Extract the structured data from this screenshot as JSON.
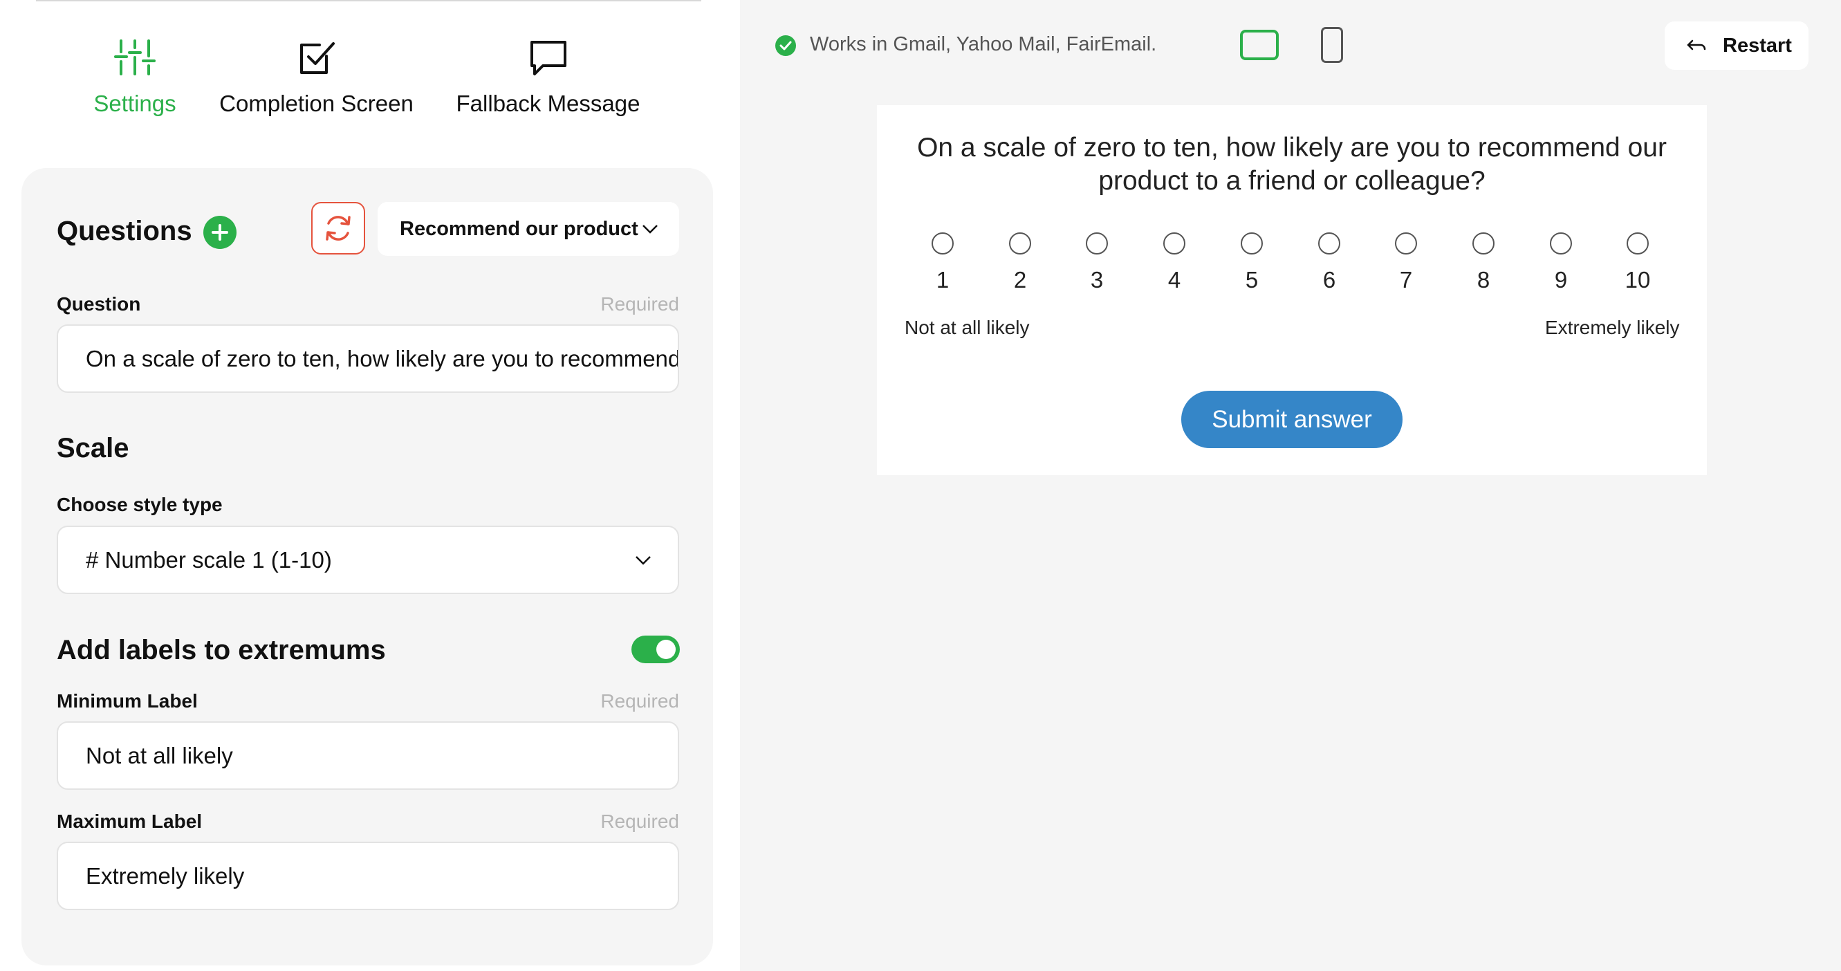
{
  "tabs": [
    {
      "label": "Settings",
      "icon": "sliders-icon",
      "active": true
    },
    {
      "label": "Completion Screen",
      "icon": "checkbox-icon",
      "active": false
    },
    {
      "label": "Fallback Message",
      "icon": "chat-bubble-icon",
      "active": false
    }
  ],
  "questions": {
    "title": "Questions",
    "selected_question": "Recommend our product",
    "question_label": "Question",
    "question_required": "Required",
    "question_value": "On a scale of zero to ten, how likely are you to recommend our product to a friend or colleague?"
  },
  "scale": {
    "title": "Scale",
    "style_label": "Choose style type",
    "style_value": "# Number scale 1 (1-10)"
  },
  "extremums": {
    "title": "Add labels to extremums",
    "enabled": true,
    "min_label": "Minimum Label",
    "min_required": "Required",
    "min_value": "Not at all likely",
    "max_label": "Maximum Label",
    "max_required": "Required",
    "max_value": "Extremely likely"
  },
  "preview": {
    "compatibility": "Works in Gmail, Yahoo Mail, FairEmail.",
    "restart_label": "Restart",
    "question": "On a scale of zero to ten, how likely are you to recommend our product to a friend or colleague?",
    "scale": [
      "1",
      "2",
      "3",
      "4",
      "5",
      "6",
      "7",
      "8",
      "9",
      "10"
    ],
    "min_label": "Not at all likely",
    "max_label": "Extremely likely",
    "submit_label": "Submit answer"
  },
  "colors": {
    "accent_green": "#2bb04a",
    "refresh_red": "#e5533d",
    "submit_blue": "#3586c8",
    "panel_gray": "#f5f5f5"
  }
}
